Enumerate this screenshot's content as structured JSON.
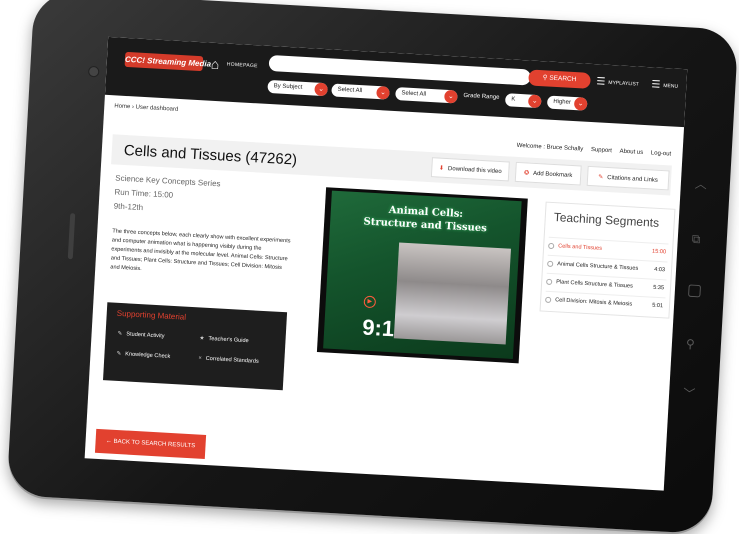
{
  "header": {
    "logo_text": "CCC! Streaming Media",
    "home_label": "HOMEPAGE",
    "search_placeholder": "",
    "search_button": "SEARCH",
    "myplaylist_label": "MYPLAYLIST",
    "menu_label": "MENU",
    "filters": {
      "subject": "By Subject",
      "select_all_1": "Select All",
      "select_all_2": "Select All",
      "grade_range_label": "Grade Range",
      "grade_from": "K",
      "grade_to": "Higher"
    }
  },
  "breadcrumb": "Home › User dashboard",
  "user_bar": {
    "welcome": "Welcome : Bruce Schally",
    "support": "Support",
    "about": "About us",
    "logout": "Log-out"
  },
  "page": {
    "title": "Cells and Tissues (47262)",
    "download_button": "Download this video",
    "bookmark_button": "Add Bookmark",
    "citations_button": "Citations and Links",
    "series": "Science Key Concepts Series",
    "run_time": "Run Time: 15:00",
    "grades": "9th-12th",
    "description": "The three concepts below, each clearly show with excellent experiments and computer animation what is happening visibly during the experiments and invisibly at the molecular level. Animal Cells: Structure and Tissues; Plant Cells: Structure and Tissues; Cell Division: Mitosis and Meiosis."
  },
  "supporting": {
    "title": "Supporting Material",
    "student_activity": "Student Activity",
    "teachers_guide": "Teacher's Guide",
    "knowledge_check": "Knowledge Check",
    "correlated_standards": "Correlated Standards"
  },
  "video": {
    "title_line1": "Animal Cells:",
    "title_line2": "Structure and Tissues",
    "badge": "9:1"
  },
  "teaching": {
    "title": "Teaching Segments",
    "segments": [
      {
        "name": "Cells and Tissues",
        "time": "15:00"
      },
      {
        "name": "Animal Cells Structure & Tissues",
        "time": "4:03"
      },
      {
        "name": "Plant Cells Structure & Tissues",
        "time": "5:35"
      },
      {
        "name": "Cell Division: Mitosis & Meiosis",
        "time": "5:01"
      }
    ]
  },
  "back_button": "BACK TO SEARCH RESULTS",
  "colors": {
    "accent": "#e2412f",
    "topbar": "#1a1a1a",
    "bezel": "#151515"
  }
}
